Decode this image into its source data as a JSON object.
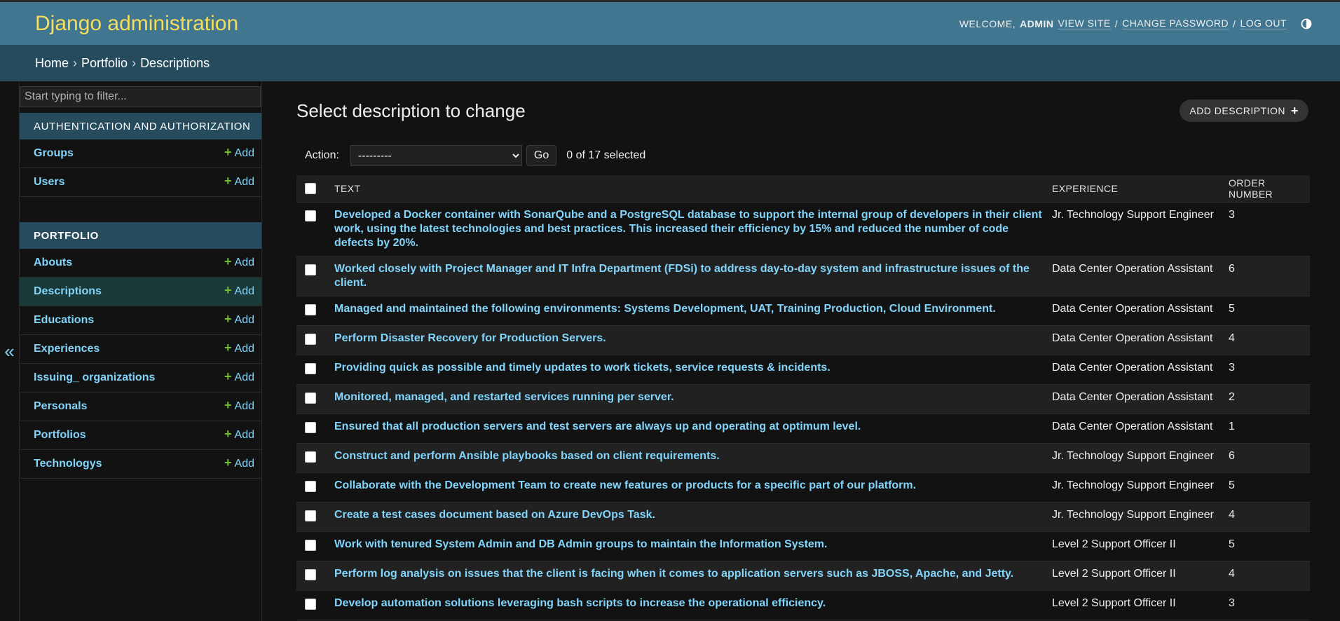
{
  "header": {
    "site_title": "Django administration",
    "welcome": "WELCOME,",
    "username": "ADMIN",
    "view_site": "VIEW SITE",
    "change_password": "CHANGE PASSWORD",
    "log_out": "LOG OUT",
    "sep1": "/",
    "sep2": "/",
    "theme_icon": "theme-toggle-icon"
  },
  "breadcrumbs": {
    "home": "Home",
    "app": "Portfolio",
    "current": "Descriptions",
    "sep": "›"
  },
  "sidebar": {
    "filter_placeholder": "Start typing to filter...",
    "collapse_label": "«",
    "add_label": "Add",
    "apps": [
      {
        "name": "AUTHENTICATION AND AUTHORIZATION",
        "models": [
          {
            "label": "Groups"
          },
          {
            "label": "Users"
          }
        ]
      },
      {
        "name": "PORTFOLIO",
        "models": [
          {
            "label": "Abouts"
          },
          {
            "label": "Descriptions"
          },
          {
            "label": "Educations"
          },
          {
            "label": "Experiences"
          },
          {
            "label": "Issuing_ organizations"
          },
          {
            "label": "Personals"
          },
          {
            "label": "Portfolios"
          },
          {
            "label": "Technologys"
          }
        ]
      }
    ]
  },
  "main": {
    "title": "Select description to change",
    "add_button": "ADD DESCRIPTION",
    "action_label": "Action:",
    "action_selected": "---------",
    "go_label": "Go",
    "selected_count": "0 of 17 selected",
    "columns": [
      "TEXT",
      "EXPERIENCE",
      "ORDER NUMBER"
    ],
    "rows": [
      {
        "text": "Developed a Docker container with SonarQube and a PostgreSQL database to support the internal group of developers in their client work, using the latest technologies and best practices. This increased their efficiency by 15% and reduced the number of code defects by 20%.",
        "experience": "Jr. Technology Support Engineer",
        "order": "3"
      },
      {
        "text": "Worked closely with Project Manager and IT Infra Department (FDSi) to address day-to-day system and infrastructure issues of the client.",
        "experience": "Data Center Operation Assistant",
        "order": "6"
      },
      {
        "text": "Managed and maintained the following environments: Systems Development, UAT, Training Production, Cloud Environment.",
        "experience": "Data Center Operation Assistant",
        "order": "5"
      },
      {
        "text": "Perform Disaster Recovery for Production Servers.",
        "experience": "Data Center Operation Assistant",
        "order": "4"
      },
      {
        "text": "Providing quick as possible and timely updates to work tickets, service requests & incidents.",
        "experience": "Data Center Operation Assistant",
        "order": "3"
      },
      {
        "text": "Monitored, managed, and restarted services running per server.",
        "experience": "Data Center Operation Assistant",
        "order": "2"
      },
      {
        "text": "Ensured that all production servers and test servers are always up and operating at optimum level.",
        "experience": "Data Center Operation Assistant",
        "order": "1"
      },
      {
        "text": "Construct and perform Ansible playbooks based on client requirements.",
        "experience": "Jr. Technology Support Engineer",
        "order": "6"
      },
      {
        "text": "Collaborate with the Development Team to create new features or products for a specific part of our platform.",
        "experience": "Jr. Technology Support Engineer",
        "order": "5"
      },
      {
        "text": "Create a test cases document based on Azure DevOps Task.",
        "experience": "Jr. Technology Support Engineer",
        "order": "4"
      },
      {
        "text": "Work with tenured System Admin and DB Admin groups to maintain the Information System.",
        "experience": "Level 2 Support Officer II",
        "order": "5"
      },
      {
        "text": "Perform log analysis on issues that the client is facing when it comes to application servers such as JBOSS, Apache, and Jetty.",
        "experience": "Level 2 Support Officer II",
        "order": "4"
      },
      {
        "text": "Develop automation solutions leveraging bash scripts to increase the operational efficiency.",
        "experience": "Level 2 Support Officer II",
        "order": "3"
      }
    ]
  },
  "colors": {
    "header_bg": "#417690",
    "breadcrumb_bg": "#264b5d",
    "site_title": "#f5dd5d",
    "link": "#81d4fa",
    "add_plus": "#70bf2b",
    "page_bg": "#121212"
  }
}
